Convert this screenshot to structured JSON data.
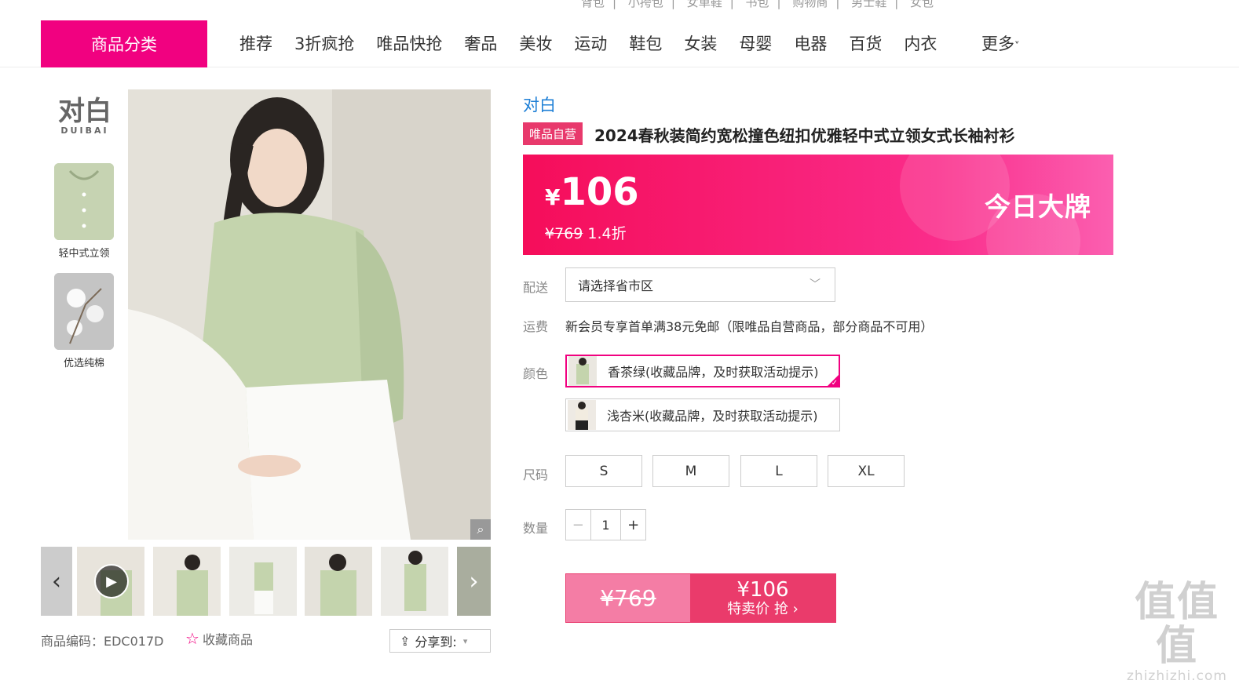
{
  "top_links": [
    "背包",
    "小挎包",
    "女单鞋",
    "书包",
    "购物商",
    "男士鞋",
    "女包"
  ],
  "nav": {
    "category_button": "商品分类",
    "links": [
      "推荐",
      "3折疯抢",
      "唯品快抢",
      "奢品",
      "美妆",
      "运动",
      "鞋包",
      "女装",
      "母婴",
      "电器",
      "百货",
      "内衣"
    ],
    "more": "更多"
  },
  "brand_logo": {
    "big": "对白",
    "small": "DUIBAI"
  },
  "features": [
    {
      "label": "轻中式立领"
    },
    {
      "label": "优选纯棉"
    }
  ],
  "product": {
    "brand": "对白",
    "self_badge": "唯品自营",
    "title": "2024春秋装简约宽松撞色纽扣优雅轻中式立领女式长袖衬衫",
    "code_label": "商品编码：EDC017D",
    "fav_label": "收藏商品",
    "share_label": "分享到:"
  },
  "price": {
    "currency": "¥",
    "current": "106",
    "original": "¥769",
    "discount": "1.4折",
    "banner": "今日大牌"
  },
  "delivery": {
    "label": "配送",
    "placeholder": "请选择省市区"
  },
  "shipping": {
    "label": "运费",
    "text": "新会员专享首单满38元免邮（限唯品自营商品，部分商品不可用）"
  },
  "colors": {
    "label": "颜色",
    "options": [
      {
        "name": "香茶绿(收藏品牌，及时获取活动提示)",
        "selected": true
      },
      {
        "name": "浅杏米(收藏品牌，及时获取活动提示)",
        "selected": false
      }
    ]
  },
  "sizes": {
    "label": "尺码",
    "options": [
      "S",
      "M",
      "L",
      "XL"
    ]
  },
  "quantity": {
    "label": "数量",
    "minus": "−",
    "value": "1",
    "plus": "+"
  },
  "buy": {
    "original": "¥769",
    "price": "¥106",
    "action": "特卖价 抢 ›"
  },
  "watermark": {
    "main": "值值值",
    "url": "zhizhizhi.com"
  },
  "colors_theme": {
    "accent": "#f10180",
    "badge": "#e8396c",
    "link": "#1e7fd6"
  }
}
